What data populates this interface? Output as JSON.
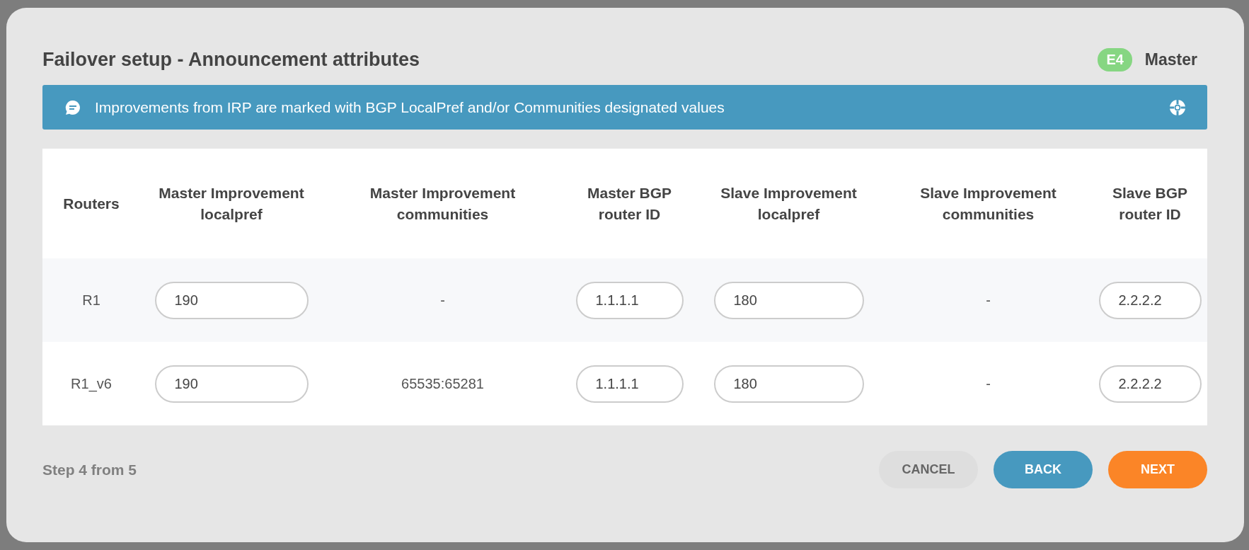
{
  "dialog": {
    "title": "Failover setup - Announcement attributes",
    "badge": "E4",
    "role": "Master"
  },
  "banner": {
    "text": "Improvements from IRP are marked with BGP LocalPref and/or Communities designated values"
  },
  "table": {
    "columns": [
      "Routers",
      "Master Improvement localpref",
      "Master Improvement communities",
      "Master BGP router ID",
      "Slave Improvement localpref",
      "Slave Improvement communities",
      "Slave BGP router ID"
    ],
    "rows": [
      {
        "cells": [
          {
            "kind": "text",
            "value": "R1"
          },
          {
            "kind": "input",
            "value": "190"
          },
          {
            "kind": "text",
            "value": "-"
          },
          {
            "kind": "input",
            "value": "1.1.1.1"
          },
          {
            "kind": "input",
            "value": "180"
          },
          {
            "kind": "text",
            "value": "-"
          },
          {
            "kind": "input",
            "value": "2.2.2.2"
          }
        ]
      },
      {
        "cells": [
          {
            "kind": "text",
            "value": "R1_v6"
          },
          {
            "kind": "input",
            "value": "190"
          },
          {
            "kind": "text",
            "value": "65535:65281"
          },
          {
            "kind": "input",
            "value": "1.1.1.1"
          },
          {
            "kind": "input",
            "value": "180"
          },
          {
            "kind": "text",
            "value": "-"
          },
          {
            "kind": "input",
            "value": "2.2.2.2"
          }
        ]
      }
    ]
  },
  "footer": {
    "step": "Step 4 from 5",
    "buttons": [
      {
        "label": "CANCEL",
        "kind": "plain"
      },
      {
        "label": "BACK",
        "kind": "secondary"
      },
      {
        "label": "NEXT",
        "kind": "primary"
      }
    ]
  }
}
